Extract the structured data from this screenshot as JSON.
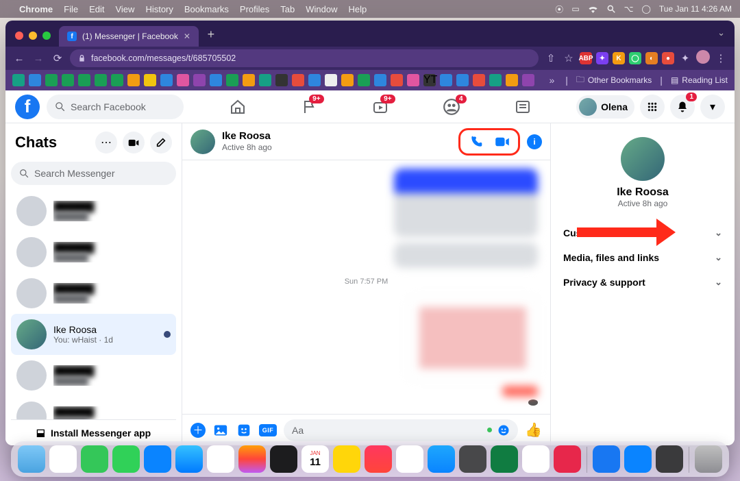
{
  "macos": {
    "app": "Chrome",
    "menus": [
      "File",
      "Edit",
      "View",
      "History",
      "Bookmarks",
      "Profiles",
      "Tab",
      "Window",
      "Help"
    ],
    "clock": "Tue Jan 11  4:26 AM"
  },
  "browser": {
    "tab_title": "(1) Messenger | Facebook",
    "url": "facebook.com/messages/t/685705502",
    "bookmarks_folder": "Other Bookmarks",
    "reading_list": "Reading List"
  },
  "fb_header": {
    "search_placeholder": "Search Facebook",
    "badges": {
      "pages": "9+",
      "watch": "9+",
      "groups": "4"
    },
    "user_name": "Olena",
    "notif_badge": "1"
  },
  "chats": {
    "title": "Chats",
    "search_placeholder": "Search Messenger",
    "items": [
      {
        "name": "██████",
        "sub": "██████"
      },
      {
        "name": "██████",
        "sub": "██████"
      },
      {
        "name": "██████",
        "sub": "██████"
      },
      {
        "name": "Ike Roosa",
        "sub": "You: wHaist · 1d",
        "active": true
      },
      {
        "name": "██████",
        "sub": "██████"
      },
      {
        "name": "██████",
        "sub": "██████"
      },
      {
        "name": "██████",
        "sub": "██████"
      }
    ],
    "install": "Install Messenger app"
  },
  "thread": {
    "name": "Ike Roosa",
    "status": "Active 8h ago",
    "timestamp": "Sun 7:57 PM",
    "composer_placeholder": "Aa"
  },
  "details": {
    "name": "Ike Roosa",
    "status": "Active 8h ago",
    "rows": [
      "Customize chat",
      "Media, files and links",
      "Privacy & support"
    ]
  }
}
